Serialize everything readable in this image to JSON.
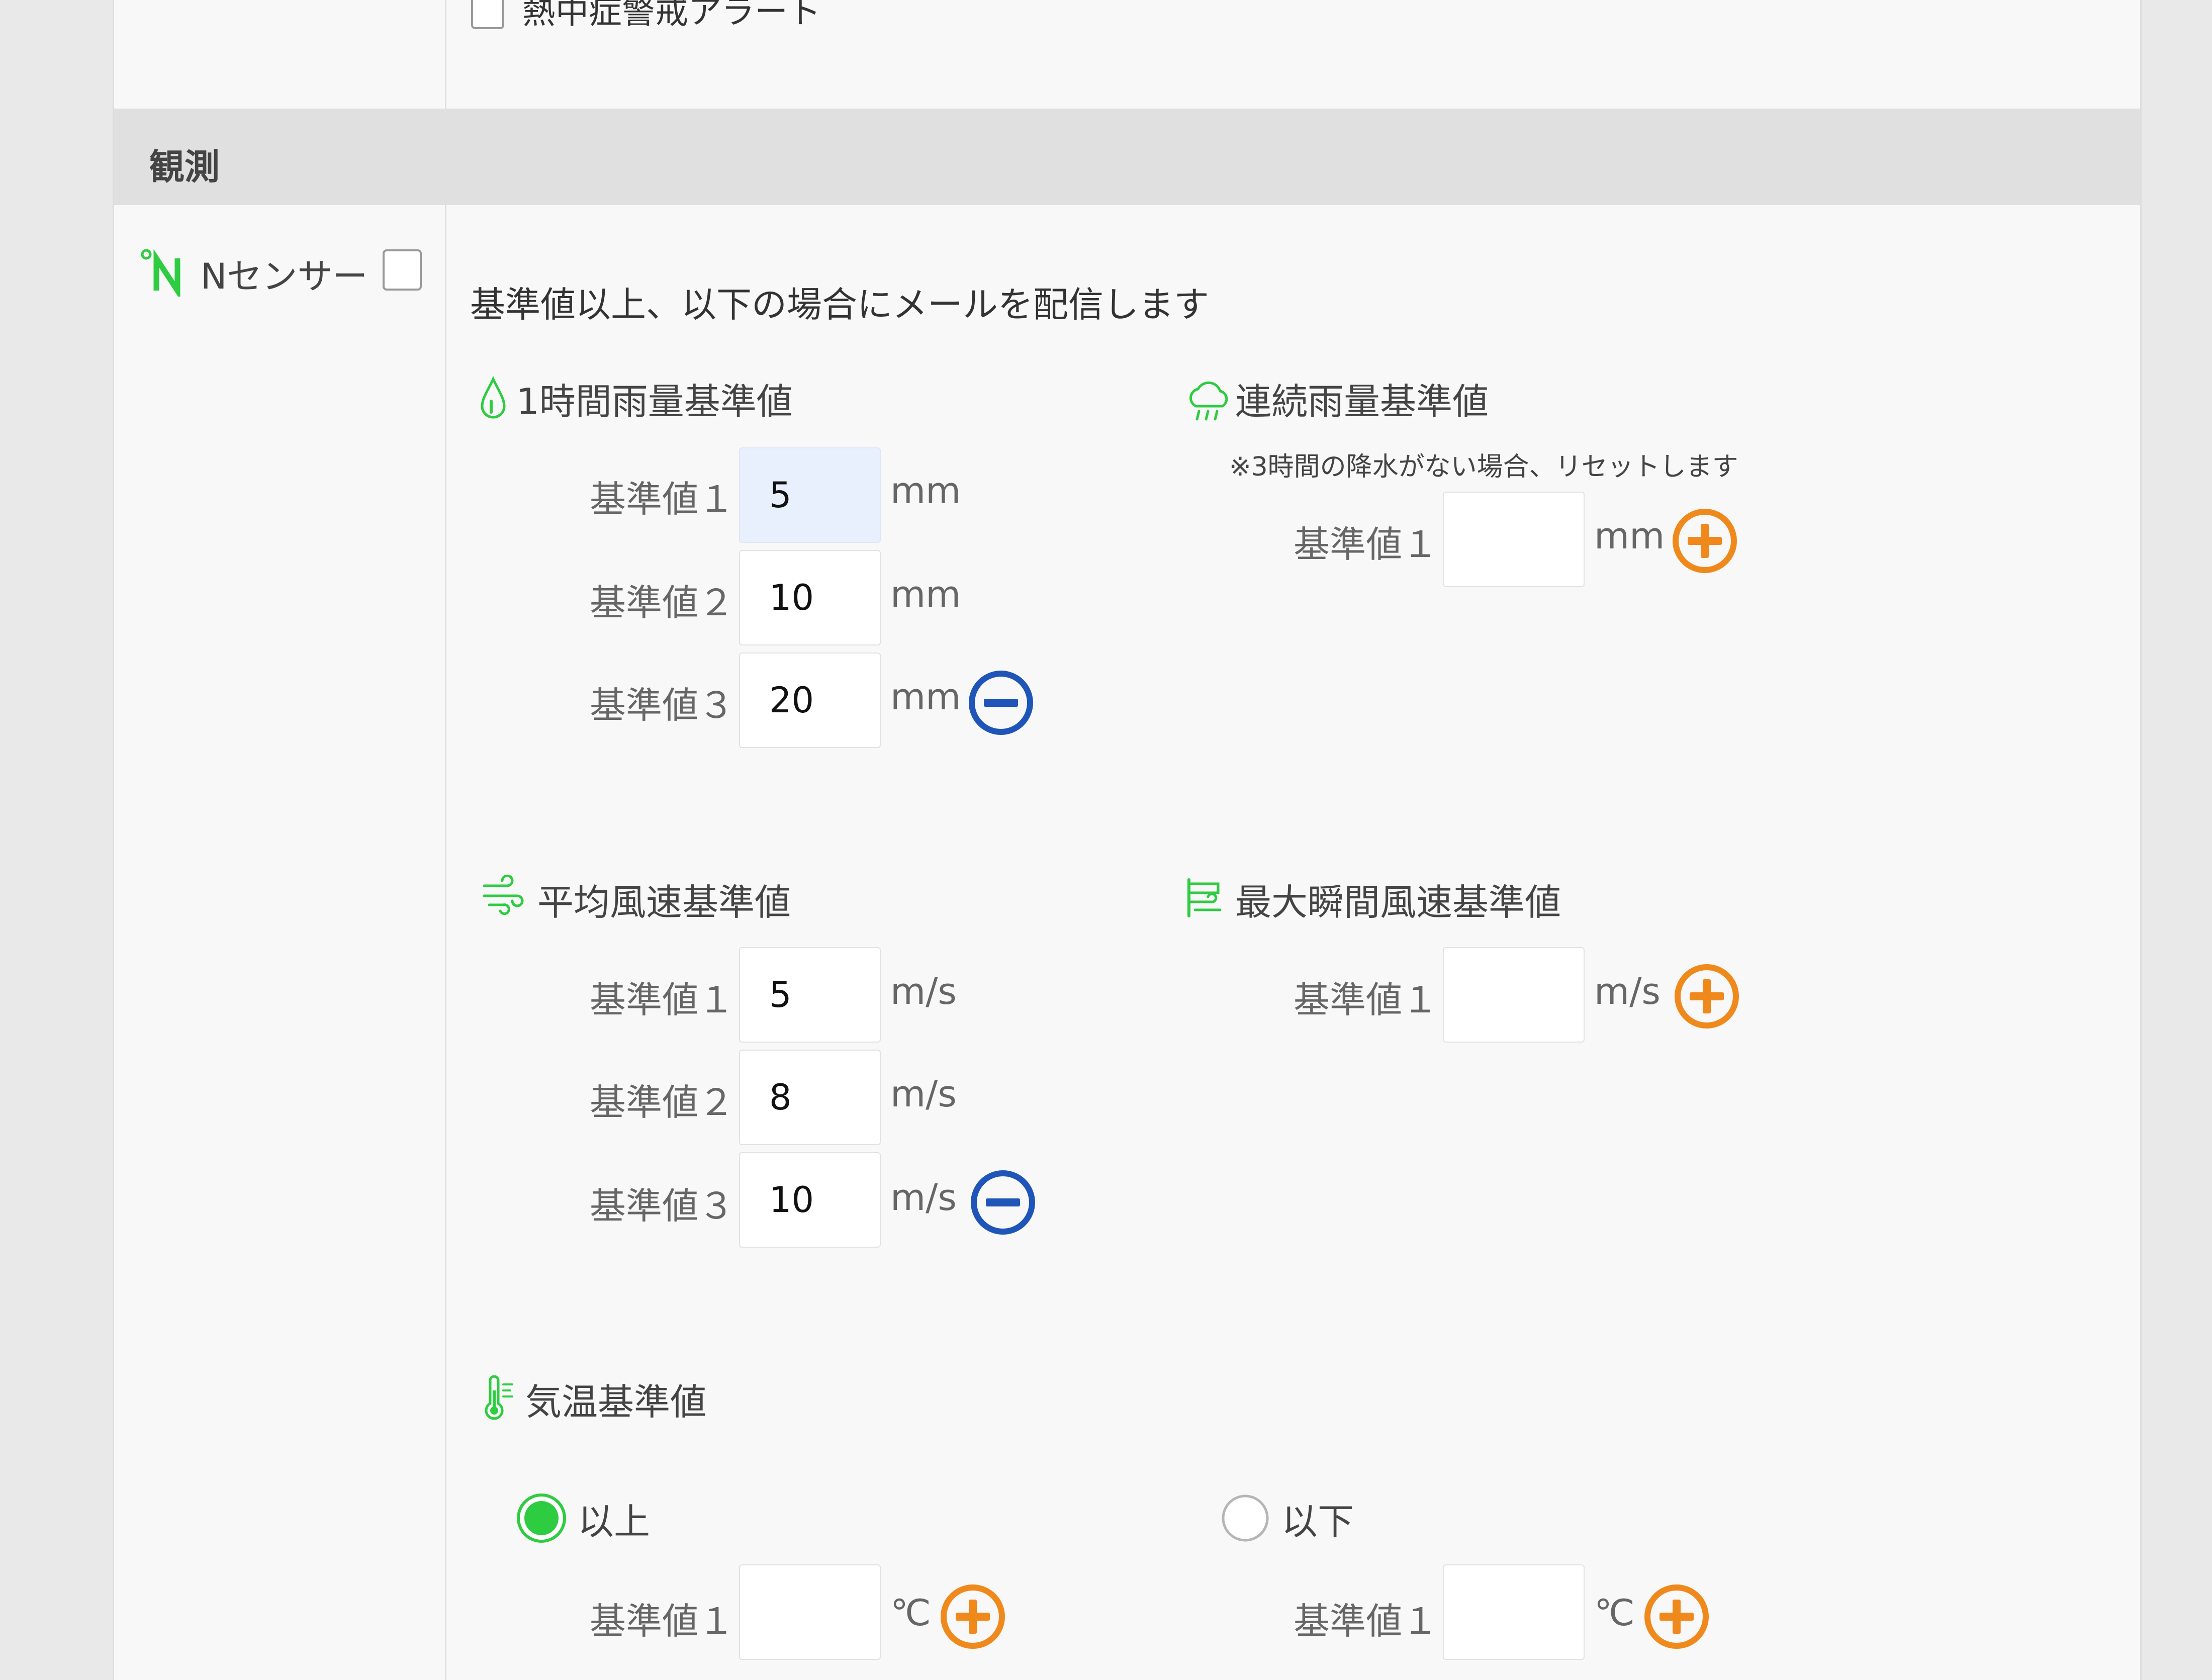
{
  "top_item": {
    "label": "熱中症警戒アラート"
  },
  "section": {
    "title": "観測"
  },
  "sensor": {
    "label": "Nセンサー"
  },
  "info_text": "基準値以上、以下の場合にメールを配信します",
  "rain_hourly": {
    "title": "1時間雨量基準値",
    "rows": [
      {
        "label": "基準値１",
        "value": "5",
        "unit": "mm"
      },
      {
        "label": "基準値２",
        "value": "10",
        "unit": "mm"
      },
      {
        "label": "基準値３",
        "value": "20",
        "unit": "mm"
      }
    ]
  },
  "rain_continuous": {
    "title": "連続雨量基準値",
    "note": "※3時間の降水がない場合、リセットします",
    "rows": [
      {
        "label": "基準値１",
        "value": "",
        "unit": "mm"
      }
    ]
  },
  "wind_avg": {
    "title": "平均風速基準値",
    "rows": [
      {
        "label": "基準値１",
        "value": "5",
        "unit": "m/s"
      },
      {
        "label": "基準値２",
        "value": "8",
        "unit": "m/s"
      },
      {
        "label": "基準値３",
        "value": "10",
        "unit": "m/s"
      }
    ]
  },
  "wind_gust": {
    "title": "最大瞬間風速基準値",
    "rows": [
      {
        "label": "基準値１",
        "value": "",
        "unit": "m/s"
      }
    ]
  },
  "temperature": {
    "title": "気温基準値",
    "above": {
      "label": "以上",
      "selected": true,
      "rows": [
        {
          "label": "基準値１",
          "value": "",
          "unit": "℃"
        }
      ]
    },
    "below": {
      "label": "以下",
      "selected": false,
      "rows": [
        {
          "label": "基準値１",
          "value": "",
          "unit": "℃"
        }
      ]
    }
  },
  "colors": {
    "accent_green": "#2ecc40",
    "add_orange": "#f0891c",
    "remove_blue": "#1f55b8"
  },
  "icons": {
    "sensor": "n-sensor-icon",
    "rain_hourly": "raindrop-icon",
    "rain_continuous": "rain-cloud-icon",
    "wind_avg": "wind-icon",
    "wind_gust": "wind-gust-icon",
    "temperature": "thermometer-icon",
    "add": "plus-circle-icon",
    "remove": "minus-circle-icon"
  }
}
